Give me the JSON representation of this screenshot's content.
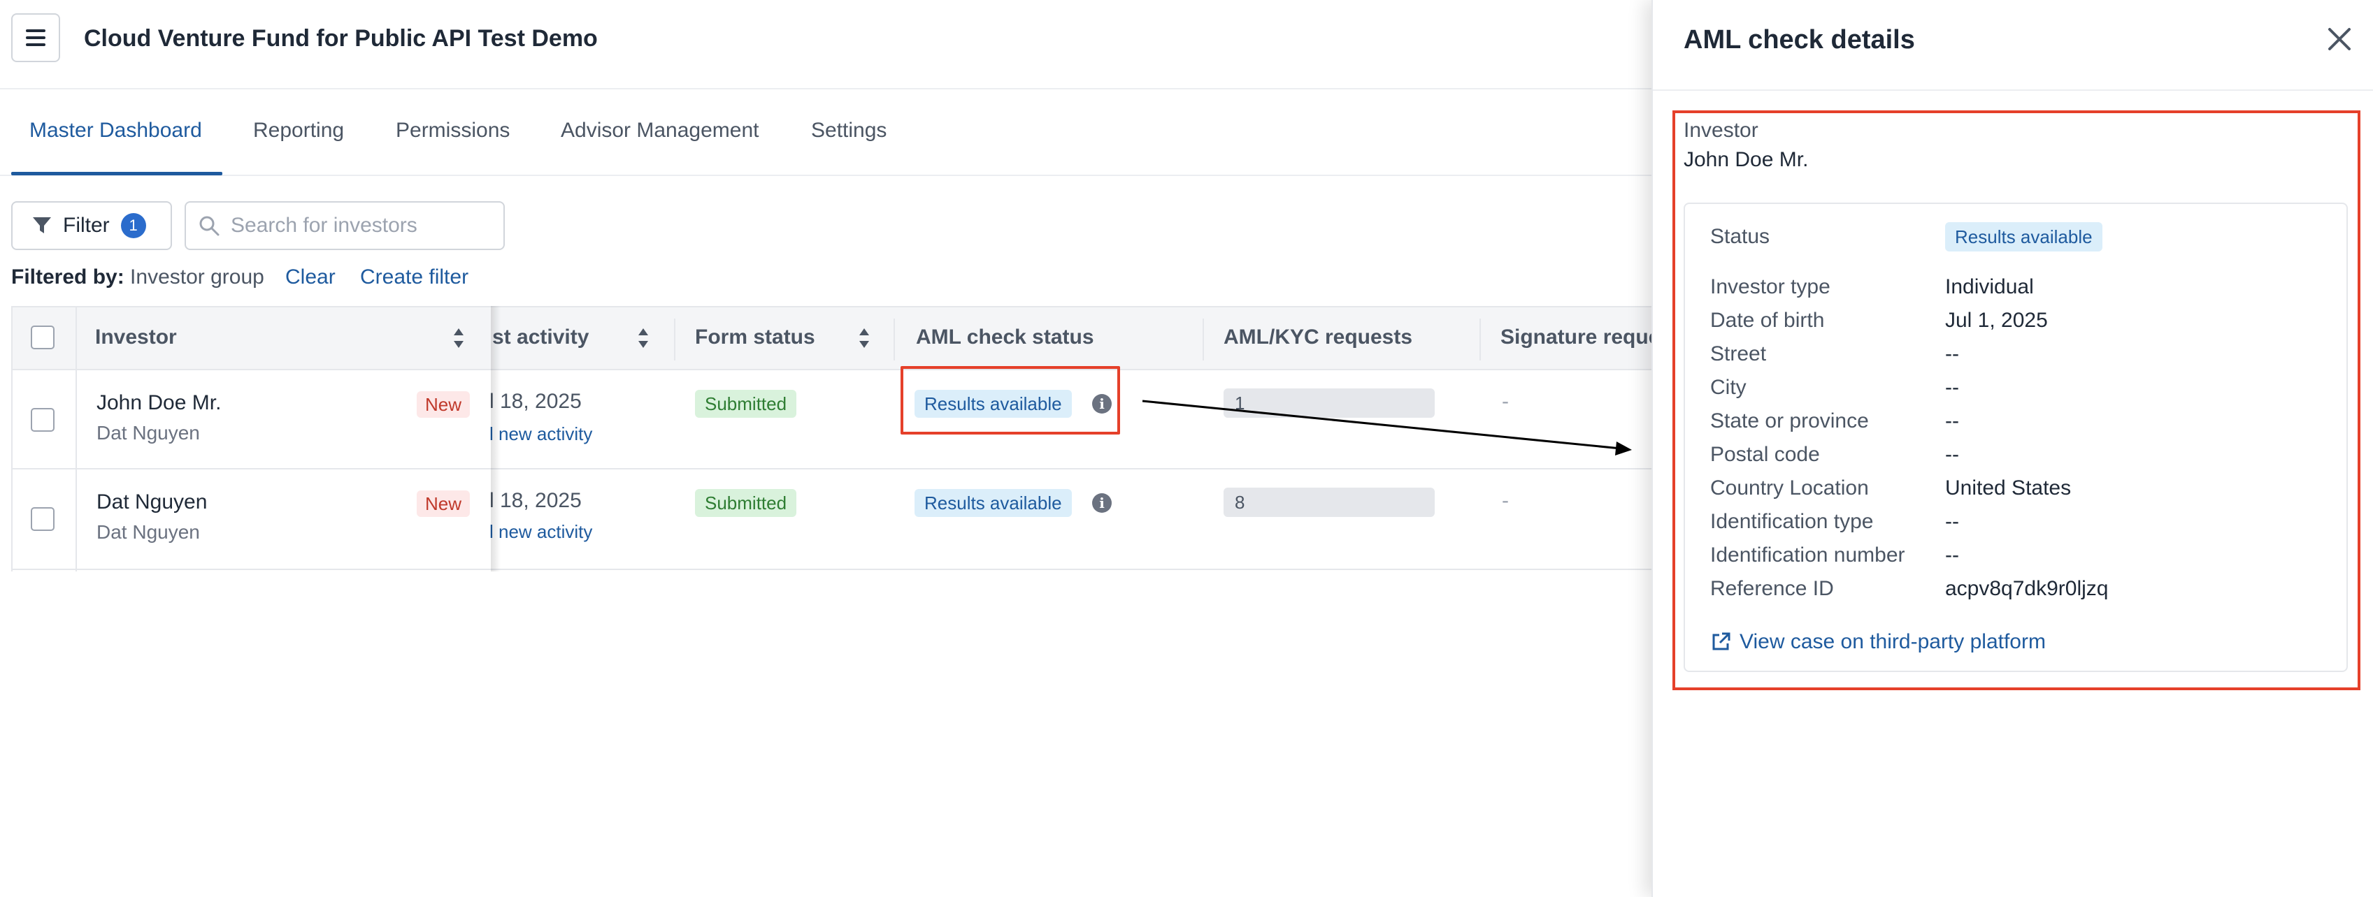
{
  "app": {
    "fund_title": "Cloud Venture Fund for Public API Test Demo"
  },
  "tabs": [
    {
      "label": "Master Dashboard",
      "active": true
    },
    {
      "label": "Reporting"
    },
    {
      "label": "Permissions"
    },
    {
      "label": "Advisor Management"
    },
    {
      "label": "Settings"
    }
  ],
  "toolbar": {
    "filter_label": "Filter",
    "filter_count": "1",
    "search_placeholder": "Search for investors",
    "filtered_by_label": "Filtered by:",
    "filtered_by_value": "Investor group",
    "clear_label": "Clear",
    "create_filter_label": "Create filter"
  },
  "table": {
    "headers": {
      "investor": "Investor",
      "last_activity": "st activity",
      "form_status": "Form status",
      "aml_status": "AML check status",
      "aml_requests": "AML/KYC requests",
      "signature": "Signature reque"
    },
    "rows": [
      {
        "name": "John Doe Mr.",
        "sub": "Dat Nguyen",
        "badge": "New",
        "activity_date": "l 18, 2025",
        "activity_link": "l new activity",
        "form_status": "Submitted",
        "aml_status": "Results available",
        "aml_requests": "1",
        "signature": "-"
      },
      {
        "name": "Dat Nguyen",
        "sub": "Dat Nguyen",
        "badge": "New",
        "activity_date": "l 18, 2025",
        "activity_link": "l new activity",
        "form_status": "Submitted",
        "aml_status": "Results available",
        "aml_requests": "8",
        "signature": "-"
      }
    ]
  },
  "panel": {
    "title": "AML check details",
    "investor_label": "Investor",
    "investor_value": "John Doe Mr.",
    "status_label": "Status",
    "status_value": "Results available",
    "fields": [
      {
        "label": "Investor type",
        "value": "Individual"
      },
      {
        "label": "Date of birth",
        "value": "Jul 1, 2025"
      },
      {
        "label": "Street",
        "value": "--"
      },
      {
        "label": "City",
        "value": "--"
      },
      {
        "label": "State or province",
        "value": "--"
      },
      {
        "label": "Postal code",
        "value": "--"
      },
      {
        "label": "Country Location",
        "value": "United States"
      },
      {
        "label": "Identification type",
        "value": "--"
      },
      {
        "label": "Identification number",
        "value": "--"
      },
      {
        "label": "Reference ID",
        "value": "acpv8q7dk9r0ljzq"
      }
    ],
    "external_link": "View case on third-party platform"
  },
  "colors": {
    "accent": "#1e5a9e",
    "highlight": "#e5402a",
    "success": "#2e7d32",
    "danger": "#c0392b"
  },
  "icons": [
    "menu-icon",
    "filter-icon",
    "search-icon",
    "sort-icon",
    "info-icon",
    "close-icon",
    "external-link-icon"
  ]
}
